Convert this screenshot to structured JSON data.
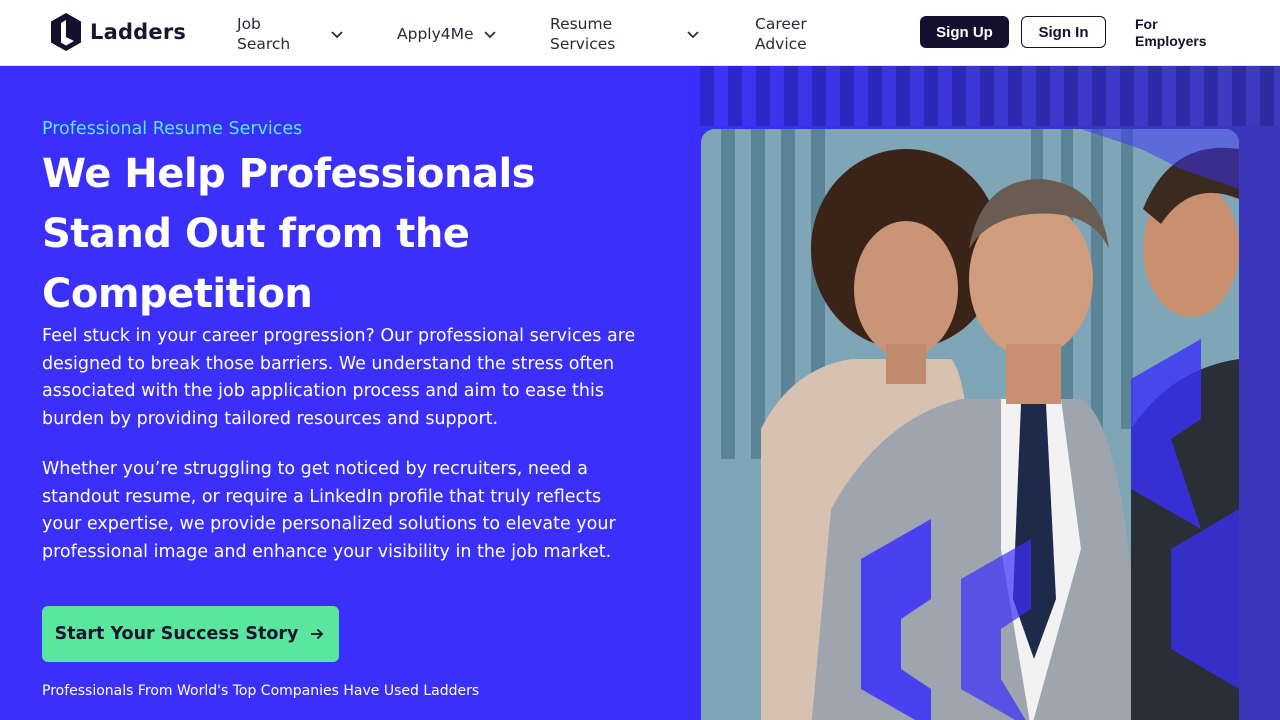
{
  "brand": {
    "name": "Ladders"
  },
  "nav": {
    "job_search": "Job Search",
    "apply4me": "Apply4Me",
    "resume_services": "Resume Services",
    "career_advice": "Career Advice",
    "sign_up": "Sign Up",
    "sign_in": "Sign In",
    "for_employers": "For Employers"
  },
  "hero": {
    "eyebrow": "Professional Resume Services",
    "headline": "We Help Professionals Stand Out from the Competition",
    "paragraph_1": "Feel stuck in your career progression? Our professional services are designed to break those barriers. We understand the stress often associated with the job application process and aim to ease this burden by providing tailored resources and support.",
    "paragraph_2": "Whether you’re struggling to get noticed by recruiters, need a standout resume, or require a LinkedIn profile that truly reflects your expertise, we provide personalized solutions to elevate your professional image and enhance your visibility in the job market.",
    "cta_label": "Start Your Success Story",
    "trust_line": "Professionals From World's Top Companies Have Used Ladders"
  },
  "colors": {
    "hero_bg": "#3a2ffb",
    "eyebrow": "#5fe6e0",
    "cta": "#5be69e",
    "dark": "#15102e"
  },
  "icons": [
    "ladders-logo-icon",
    "chevron-down-icon",
    "arrow-right-icon"
  ]
}
